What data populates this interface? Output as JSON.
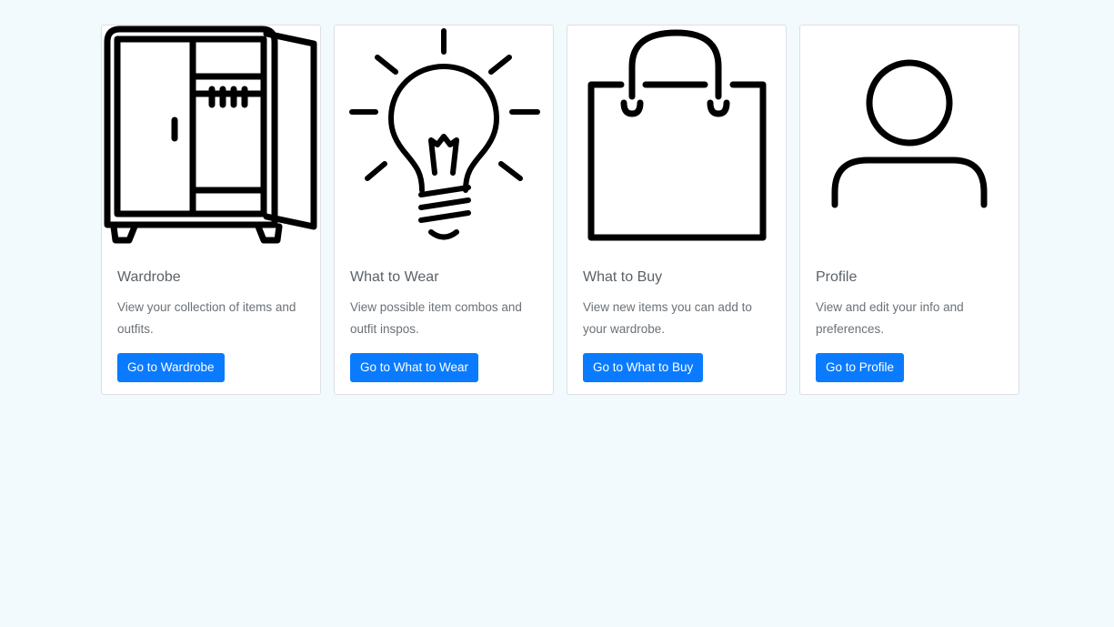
{
  "cards": [
    {
      "icon": "wardrobe-icon",
      "title": "Wardrobe",
      "text": "View your collection of items and outfits.",
      "button": "Go to Wardrobe"
    },
    {
      "icon": "lightbulb-icon",
      "title": "What to Wear",
      "text": "View possible item combos and outfit inspos.",
      "button": "Go to What to Wear"
    },
    {
      "icon": "shopping-bag-icon",
      "title": "What to Buy",
      "text": "View new items you can add to your wardrobe.",
      "button": "Go to What to Buy"
    },
    {
      "icon": "user-icon",
      "title": "Profile",
      "text": "View and edit your info and preferences.",
      "button": "Go to Profile"
    }
  ],
  "colors": {
    "page_background": "#f3fafe",
    "button_background": "#0a7bfe",
    "button_text": "#ffffff",
    "title_text": "#5b6268",
    "body_text": "#6b7177"
  }
}
